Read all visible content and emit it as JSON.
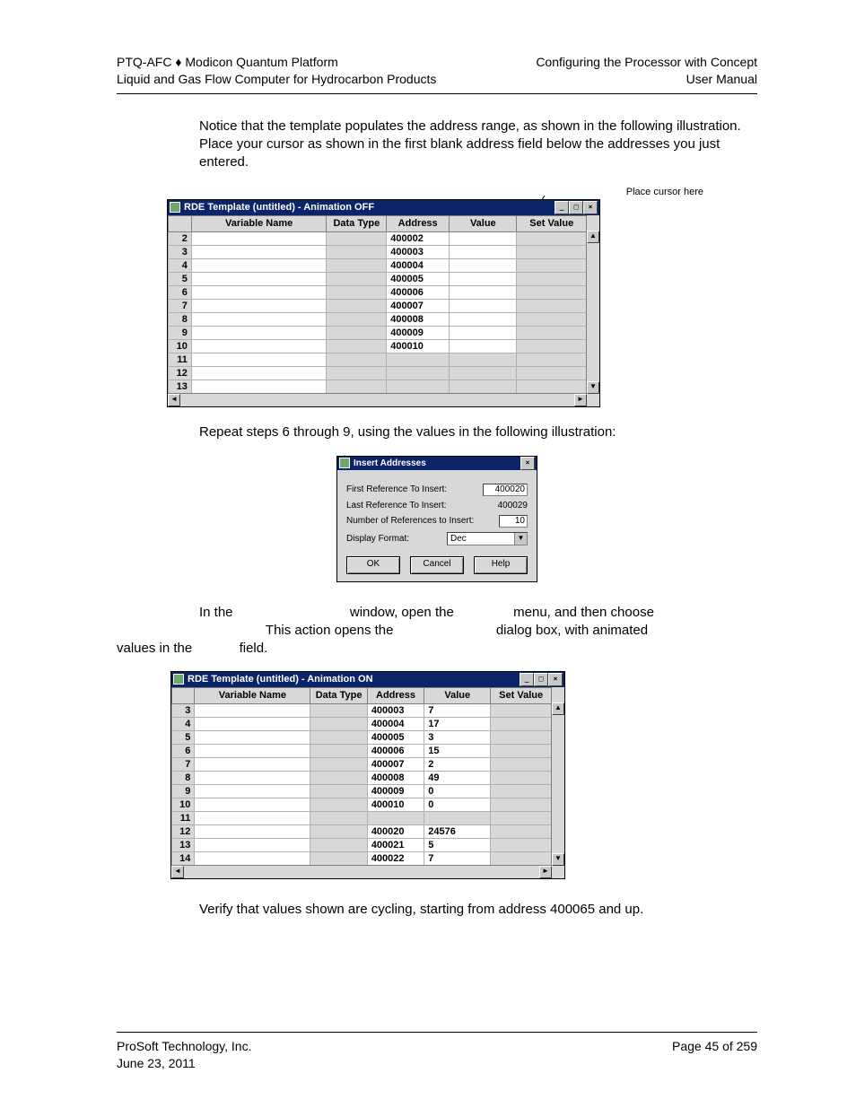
{
  "header": {
    "left1": "PTQ-AFC ♦ Modicon Quantum Platform",
    "left2": "Liquid and Gas Flow Computer for Hydrocarbon Products",
    "right1": "Configuring the Processor with Concept",
    "right2": "User Manual"
  },
  "paragraph1": "Notice that the template populates the address range, as shown in the following illustration. Place your cursor as shown in the first blank address field below the addresses you just entered.",
  "cursor_caption": "Place cursor here",
  "window1": {
    "title": "RDE Template (untitled) - Animation OFF",
    "columns": [
      "",
      "Variable Name",
      "Data Type",
      "Address",
      "Value",
      "Set Value"
    ],
    "rows": [
      {
        "n": "2",
        "address": "400002"
      },
      {
        "n": "3",
        "address": "400003"
      },
      {
        "n": "4",
        "address": "400004"
      },
      {
        "n": "5",
        "address": "400005"
      },
      {
        "n": "6",
        "address": "400006"
      },
      {
        "n": "7",
        "address": "400007"
      },
      {
        "n": "8",
        "address": "400008"
      },
      {
        "n": "9",
        "address": "400009"
      },
      {
        "n": "10",
        "address": "400010"
      },
      {
        "n": "11",
        "address": ""
      },
      {
        "n": "12",
        "address": ""
      },
      {
        "n": "13",
        "address": ""
      }
    ]
  },
  "paragraph2": "Repeat steps 6 through 9, using the values in the following illustration:",
  "dialog": {
    "title": "Insert Addresses",
    "first_label": "First Reference To Insert:",
    "first_value": "400020",
    "last_label": "Last Reference To Insert:",
    "last_value": "400029",
    "num_label": "Number of References to Insert:",
    "num_value": "10",
    "format_label": "Display Format:",
    "format_value": "Dec",
    "ok": "OK",
    "cancel": "Cancel",
    "help": "Help"
  },
  "paragraph3_part1": "In the",
  "paragraph3_part2": "window, open the",
  "paragraph3_part3": "menu, and then choose",
  "paragraph3_line2a": "This action opens the",
  "paragraph3_line2b": "dialog box, with animated",
  "paragraph3_line3a": "values in the",
  "paragraph3_line3b": "field.",
  "window3": {
    "title": "RDE Template (untitled) - Animation ON",
    "columns": [
      "",
      "Variable Name",
      "Data Type",
      "Address",
      "Value",
      "Set Value"
    ],
    "rows": [
      {
        "n": "3",
        "address": "400003",
        "value": "7"
      },
      {
        "n": "4",
        "address": "400004",
        "value": "17"
      },
      {
        "n": "5",
        "address": "400005",
        "value": "3"
      },
      {
        "n": "6",
        "address": "400006",
        "value": "15"
      },
      {
        "n": "7",
        "address": "400007",
        "value": "2"
      },
      {
        "n": "8",
        "address": "400008",
        "value": "49"
      },
      {
        "n": "9",
        "address": "400009",
        "value": "0"
      },
      {
        "n": "10",
        "address": "400010",
        "value": "0"
      },
      {
        "n": "11",
        "address": "",
        "value": ""
      },
      {
        "n": "12",
        "address": "400020",
        "value": "24576"
      },
      {
        "n": "13",
        "address": "400021",
        "value": "5"
      },
      {
        "n": "14",
        "address": "400022",
        "value": "7"
      }
    ]
  },
  "paragraph4": "Verify that values shown are cycling, starting from address 400065 and up.",
  "footer": {
    "left1": "ProSoft Technology, Inc.",
    "left2": "June 23, 2011",
    "right": "Page 45 of 259"
  },
  "winbtns": {
    "min": "_",
    "max": "□",
    "close": "×"
  },
  "arrows": {
    "up": "▲",
    "dn": "▼",
    "lf": "◄",
    "rt": "►"
  }
}
